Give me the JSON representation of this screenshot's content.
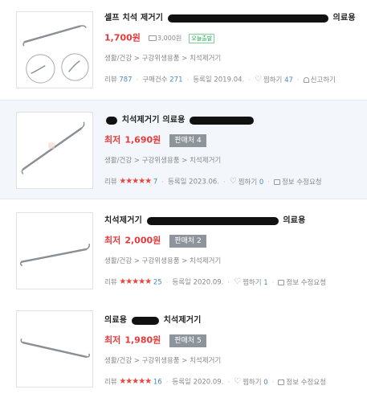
{
  "items": [
    {
      "title_before": "셀프 치석 제거기",
      "title_after": "의료용",
      "price": "1,700원",
      "shipping": "3,000원",
      "today_badge": "오늘출발",
      "category": "생활/건강 > 구강위생용품 > 치석제거기",
      "review_label": "리뷰",
      "review_count": "787",
      "purchase_label": "구매건수",
      "purchase_count": "271",
      "date": "등록일 2019.04.",
      "wish_label": "찜하기",
      "wish_count": "47",
      "report_label": "신고하기"
    },
    {
      "title_before": "",
      "title_middle": "치석제거기 의료용",
      "lowest_label": "최저",
      "price": "1,690원",
      "sellers": "판매처 4",
      "category": "생활/건강 > 구강위생용품 > 치석제거기",
      "review_label": "리뷰",
      "rating": "★★★★★",
      "review_count": "7",
      "date": "등록일 2023.06.",
      "wish_label": "찜하기",
      "wish_count": "0",
      "fix_label": "정보 수정요청"
    },
    {
      "title_before": "치석제거기",
      "title_after": "의료용",
      "lowest_label": "최저",
      "price": "2,000원",
      "sellers": "판매처 2",
      "category": "생활/건강 > 구강위생용품 > 치석제거기",
      "review_label": "리뷰",
      "rating": "★★★★★",
      "review_count": "25",
      "date": "등록일 2020.09.",
      "wish_label": "찜하기",
      "wish_count": "1",
      "fix_label": "정보 수정요청"
    },
    {
      "title_before": "의료용",
      "title_after": "치석제거기",
      "lowest_label": "최저",
      "price": "1,980원",
      "sellers": "판매처 5",
      "category": "생활/건강 > 구강위생용품 > 치석제거기",
      "review_label": "리뷰",
      "rating": "★★★★★",
      "review_count": "16",
      "date": "등록일 2020.09.",
      "wish_label": "찜하기",
      "wish_count": "0",
      "fix_label": "정보 수정요청"
    }
  ],
  "colors": {
    "price": "#e53a3a",
    "highlight_bg": "#f3f7fb",
    "count": "#4a86c5",
    "star": "#e9453c",
    "sellers_bg": "#8e949b"
  }
}
